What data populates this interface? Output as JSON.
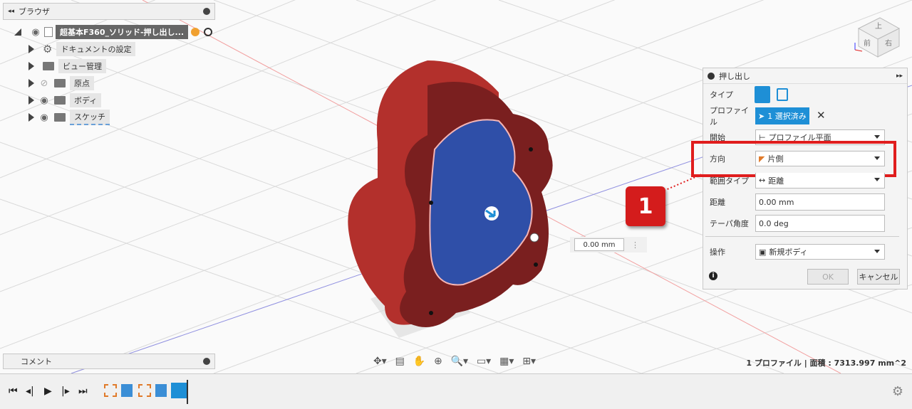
{
  "browser": {
    "title": "ブラウザ",
    "root_label": "超基本F360_ソリッド-押し出し...",
    "items": [
      {
        "label": "ドキュメントの設定",
        "icon": "gear-icon"
      },
      {
        "label": "ビュー管理",
        "icon": "folder-icon"
      },
      {
        "label": "原点",
        "icon": "folder-icon"
      },
      {
        "label": "ボディ",
        "icon": "folder-icon"
      },
      {
        "label": "スケッチ",
        "icon": "folder-icon"
      }
    ]
  },
  "comment": {
    "label": "コメント"
  },
  "dialog": {
    "title": "押し出し",
    "rows": {
      "type": {
        "label": "タイプ"
      },
      "profile": {
        "label": "プロファイル",
        "value": "1 選択済み"
      },
      "start": {
        "label": "開始",
        "value": "プロファイル平面"
      },
      "direction": {
        "label": "方向",
        "value": "片側"
      },
      "extent_type": {
        "label": "範囲タイプ",
        "value": "距離"
      },
      "distance": {
        "label": "距離",
        "value": "0.00 mm"
      },
      "taper": {
        "label": "テーパ角度",
        "value": "0.0 deg"
      },
      "operation": {
        "label": "操作",
        "value": "新規ボディ"
      }
    },
    "ok": "OK",
    "cancel": "キャンセル"
  },
  "callout_number": "1",
  "viewport_input": "0.00 mm",
  "viewcube": {
    "top": "上",
    "front": "前",
    "right": "右"
  },
  "status": "1 プロファイル | 面積 : 7313.997 mm^2",
  "colors": {
    "accent": "#1e8fd6",
    "highlight": "#e01d1d",
    "body": "#b3302c",
    "profile": "#2f4fa8"
  }
}
